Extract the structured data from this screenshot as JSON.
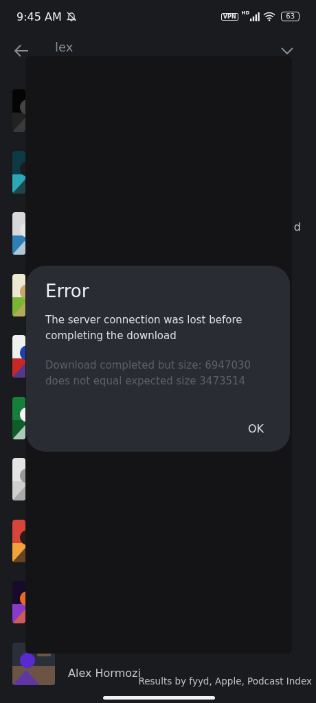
{
  "status_bar": {
    "time": "9:45 AM",
    "vpn": "VPN",
    "network": "HD",
    "battery": "63"
  },
  "search": {
    "value": "lex"
  },
  "results": [
    {
      "kind": "picture"
    },
    {
      "kind": "picture"
    },
    {
      "kind": "picture",
      "title": "d"
    },
    {
      "kind": "picture"
    },
    {
      "kind": "picture"
    },
    {
      "kind": "picture"
    },
    {
      "kind": "picture"
    },
    {
      "kind": "picture"
    },
    {
      "kind": "picture"
    },
    {
      "kind": "picture",
      "title": "Alex Hormozi"
    }
  ],
  "dialog": {
    "title": "Error",
    "message": "The server connection was lost before completing the download",
    "detail": "Download completed but size: 6947030 does not equal expected size 3473514",
    "buttons": [
      "OK"
    ]
  },
  "footer": "Results by fyyd, Apple, Podcast Index"
}
